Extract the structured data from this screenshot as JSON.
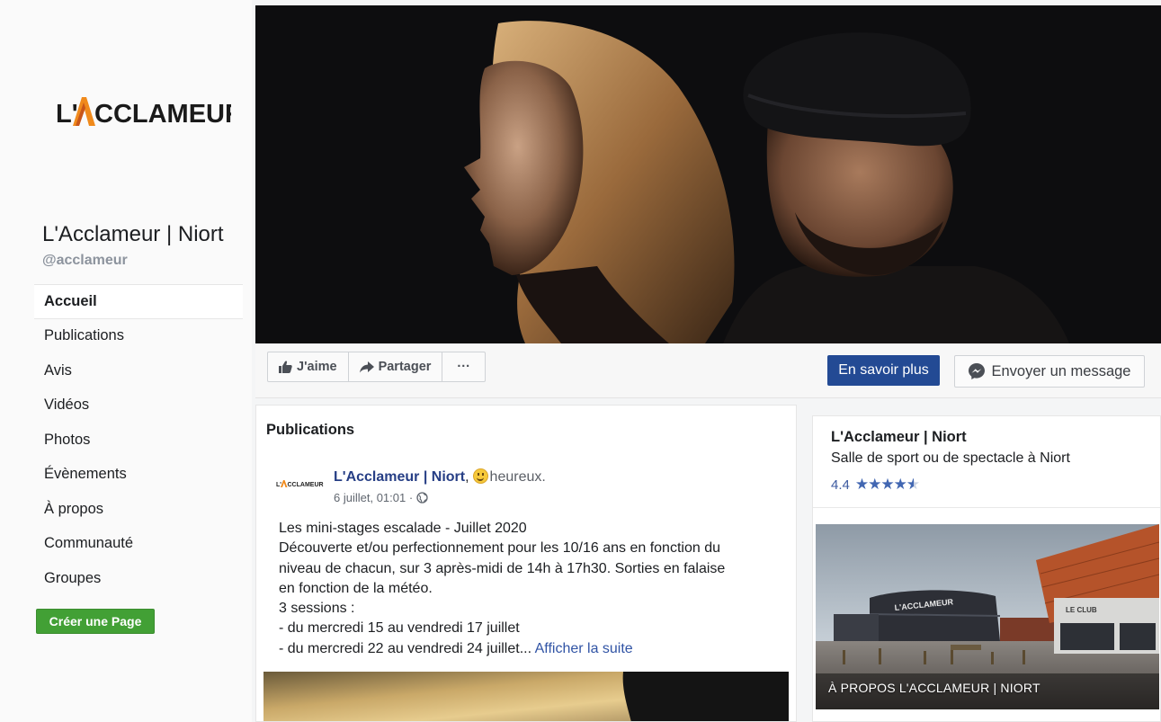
{
  "sidebar": {
    "logo_text": "L'ACCLAMEUR",
    "page_name": "L'Acclameur | Niort",
    "handle": "@acclameur",
    "nav": [
      "Accueil",
      "Publications",
      "Avis",
      "Vidéos",
      "Photos",
      "Évènements",
      "À propos",
      "Communauté",
      "Groupes"
    ],
    "create_page": "Créer une Page"
  },
  "actions": {
    "like": "J'aime",
    "share": "Partager",
    "more": "···",
    "learn_more": "En savoir plus",
    "send_message": "Envoyer un message"
  },
  "publications": {
    "title": "Publications",
    "post": {
      "avatar_text": "L'ACCLAMEUR",
      "author": "L'Acclameur | Niort",
      "separator": ",",
      "feeling": "heureux.",
      "date": "6 juillet, 01:01 ·",
      "lines": [
        "Les mini-stages escalade - Juillet 2020",
        "Découverte et/ou perfectionnement pour les 10/16 ans en fonction du",
        "niveau de chacun, sur 3 après-midi de 14h à 17h30. Sorties en falaise",
        "en fonction de la météo.",
        "3 sessions :",
        "- du mercredi 15 au vendredi 17 juillet"
      ],
      "last_line": "- du mercredi 22 au vendredi 24 juillet...",
      "see_more": "Afficher la suite"
    }
  },
  "info": {
    "name": "L'Acclameur | Niort",
    "category": "Salle de sport ou de spectacle à Niort",
    "rating": "4.4",
    "stars": "★★★★",
    "about_label": "À PROPOS L'ACCLAMEUR | NIORT",
    "building_sign": "L'ACCLAMEUR",
    "club_sign": "LE CLUB"
  },
  "colors": {
    "primary_blue": "#234a94",
    "link_blue": "#3154a5",
    "create_green": "#42a035",
    "logo_orange": "#f08a1c"
  }
}
